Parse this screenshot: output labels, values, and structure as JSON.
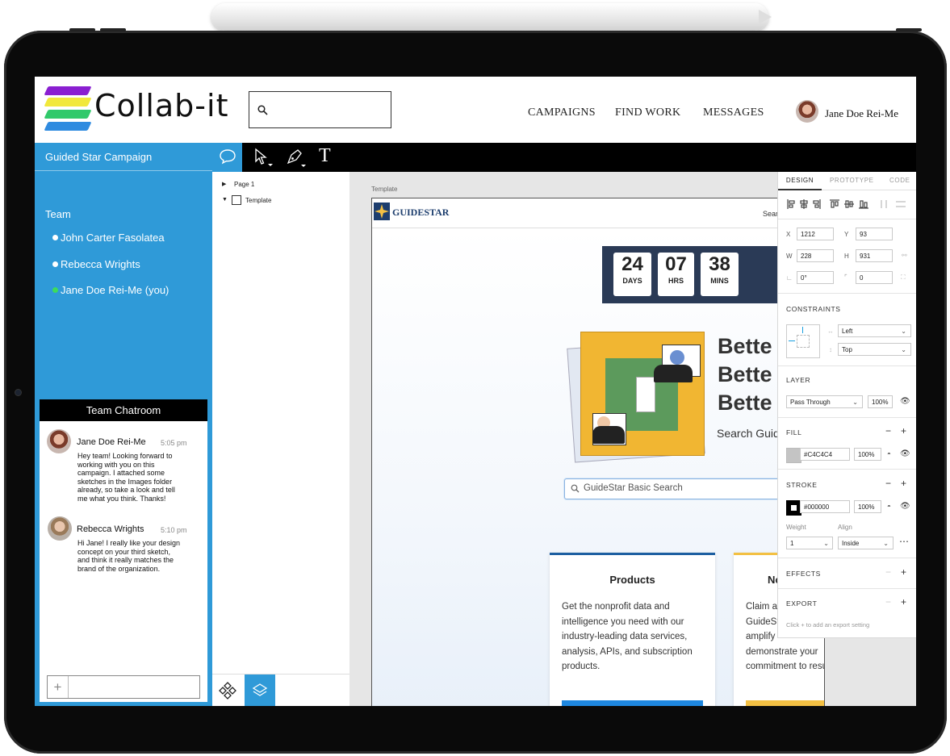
{
  "app": {
    "brand": "Collab-it"
  },
  "header": {
    "nav": [
      "CAMPAIGNS",
      "FIND WORK",
      "MESSAGES"
    ],
    "user_name": "Jane Doe Rei-Me",
    "search_placeholder": ""
  },
  "sidebar": {
    "campaign": "Guided Star Campaign",
    "team_label": "Team",
    "members": [
      {
        "name": "John Carter Fasolatea",
        "status_color": "#ffffff"
      },
      {
        "name": "Rebecca Wrights",
        "status_color": "#ffffff"
      },
      {
        "name": "Jane Doe Rei-Me (you)",
        "status_color": "#3ddc5b"
      }
    ]
  },
  "chat": {
    "title": "Team Chatroom",
    "messages": [
      {
        "name": "Jane Doe Rei-Me",
        "time": "5:05 pm",
        "text": "Hey team! Looking forward to working with you on this campaign. I attached some sketches in the Images folder already, so take a look and tell me what you think. Thanks!"
      },
      {
        "name": "Rebecca Wrights",
        "time": "5:10 pm",
        "text": "Hi Jane! I really like your design concept on your third sketch, and think it really matches the brand of the organization."
      }
    ],
    "input_value": ""
  },
  "layers": {
    "items": [
      "Page 1",
      "Template"
    ]
  },
  "canvas": {
    "artboard_label": "Template",
    "site": {
      "logo": "GUIDESTAR",
      "search_partial": "Sear",
      "countdown": [
        {
          "value": "24",
          "unit": "DAYS"
        },
        {
          "value": "07",
          "unit": "HRS"
        },
        {
          "value": "38",
          "unit": "MINS"
        }
      ],
      "headline_lines": [
        "Bette",
        "Bette",
        "Bette"
      ],
      "subhead_partial": "Search Guid",
      "search_placeholder": "GuideStar Basic Search",
      "cards": [
        {
          "title": "Products",
          "body": "Get the nonprofit data and intelligence you need with our industry-leading data services, analysis, APIs, and subscription products.",
          "accent": "#1d5fa1"
        },
        {
          "title": "No",
          "body": "Claim a GuideSt amplify demonstrate your commitment to results.",
          "body_lines": [
            "Claim a",
            "GuideSt",
            "amplify",
            "demonstrate your",
            "commitment to results."
          ],
          "accent": "#f3c043"
        }
      ]
    }
  },
  "inspector": {
    "tabs": [
      "DESIGN",
      "PROTOTYPE",
      "CODE"
    ],
    "x": "1212",
    "y": "93",
    "w": "228",
    "h": "931",
    "rotation": "0°",
    "radius": "0",
    "labels": {
      "x": "X",
      "y": "Y",
      "w": "W",
      "h": "H"
    },
    "constraints_label": "CONSTRAINTS",
    "constraint_h": "Left",
    "constraint_v": "Top",
    "layer_label": "LAYER",
    "blend": "Pass Through",
    "layer_opacity": "100%",
    "fill_label": "FILL",
    "fill_color": "#C4C4C4",
    "fill_opacity": "100%",
    "stroke_label": "STROKE",
    "stroke_color": "#000000",
    "stroke_opacity": "100%",
    "weight_label": "Weight",
    "align_label": "Align",
    "weight": "1",
    "align": "Inside",
    "effects_label": "EFFECTS",
    "export_label": "EXPORT",
    "export_hint": "Click + to add an export setting"
  },
  "colors": {
    "sidebar": "#2f9ad8",
    "toolbar": "#000000",
    "accent_active": "#2f9ad8"
  }
}
